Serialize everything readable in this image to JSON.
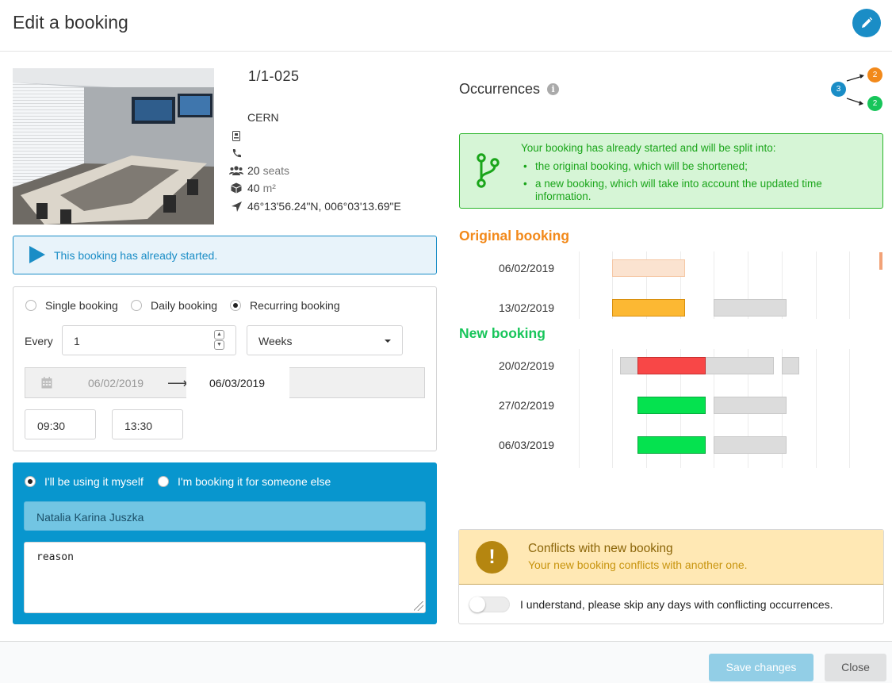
{
  "header": {
    "title": "Edit a booking"
  },
  "room": {
    "name": "1/1-025",
    "site": "CERN",
    "phone": "",
    "capacity": "20",
    "capacity_unit": "seats",
    "area": "40",
    "area_unit": "m²",
    "coordinates": "46°13'56.24\"N, 006°03'13.69\"E"
  },
  "notice": {
    "started": "This booking has already started."
  },
  "booking_type": {
    "options": [
      "Single booking",
      "Daily booking",
      "Recurring booking"
    ],
    "selected": "Recurring booking"
  },
  "recurrence": {
    "every_label": "Every",
    "interval": "1",
    "unit": "Weeks",
    "start_date": "06/02/2019",
    "end_date": "06/03/2019",
    "start_time": "09:30",
    "end_time": "13:30"
  },
  "booked_for": {
    "options": [
      "I'll be using it myself",
      "I'm booking it for someone else"
    ],
    "selected": "I'll be using it myself",
    "user": "Natalia Karina Juszka",
    "reason": "reason"
  },
  "occurrences": {
    "title": "Occurrences",
    "split_counts": {
      "total": "3",
      "original": "2",
      "new": "2"
    },
    "split_message": "Your booking has already started and will be split into:",
    "split_items": [
      "the original booking, which will be shortened;",
      "a new booking, which will take into account the updated time information."
    ],
    "original_title": "Original booking",
    "original_rows": [
      {
        "date": "06/02/2019",
        "status": "past"
      },
      {
        "date": "13/02/2019",
        "status": "pending"
      }
    ],
    "new_title": "New booking",
    "new_rows": [
      {
        "date": "20/02/2019",
        "status": "conflict"
      },
      {
        "date": "27/02/2019",
        "status": "available"
      },
      {
        "date": "06/03/2019",
        "status": "available"
      }
    ]
  },
  "conflicts": {
    "title": "Conflicts with new booking",
    "subtitle": "Your new booking conflicts with another one.",
    "toggle_label": "I understand, please skip any days with conflicting occurrences.",
    "toggle_on": false
  },
  "footer": {
    "save": "Save changes",
    "close": "Close"
  },
  "colors": {
    "primary": "#1a8dc6",
    "orange": "#f2891a",
    "green": "#17c55a",
    "conflict_red": "#f84747",
    "pending_amber": "#fcb833",
    "past_peach": "#fbe3d0"
  }
}
